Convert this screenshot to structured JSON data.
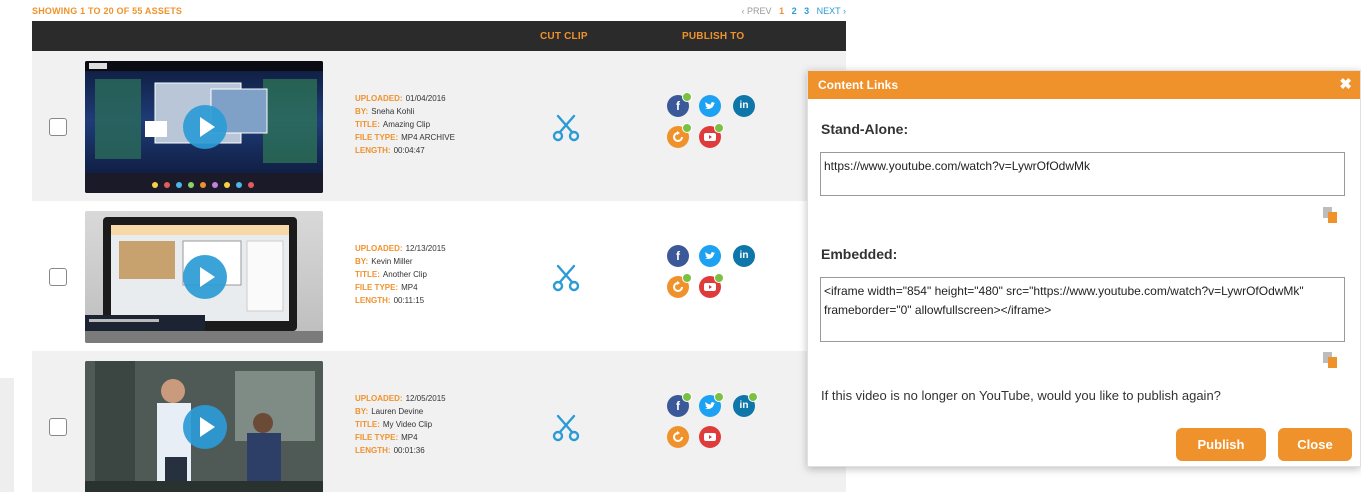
{
  "header": {
    "showing": "SHOWING 1 TO 20 OF 55 ASSETS",
    "pager": {
      "prev": "‹ PREV",
      "pages": [
        "1",
        "2",
        "3"
      ],
      "current": "1",
      "next": "NEXT ›"
    }
  },
  "table": {
    "columns": {
      "cut_clip": "CUT CLIP",
      "publish_to": "PUBLISH TO"
    },
    "labels": {
      "uploaded": "UPLOADED:",
      "by": "BY:",
      "title": "TITLE:",
      "file_type": "FILE TYPE:",
      "length": "LENGTH:"
    },
    "rows": [
      {
        "uploaded": "01/04/2016",
        "by": "Sneha Kohli",
        "title": "Amazing Clip",
        "file_type": "MP4 ARCHIVE",
        "length": "00:04:47"
      },
      {
        "uploaded": "12/13/2015",
        "by": "Kevin Miller",
        "title": "Another Clip",
        "file_type": "MP4",
        "length": "00:11:15"
      },
      {
        "uploaded": "12/05/2015",
        "by": "Lauren Devine",
        "title": "My Video Clip",
        "file_type": "MP4",
        "length": "00:01:36"
      }
    ],
    "social": {
      "facebook": "f",
      "linkedin": "in"
    }
  },
  "modal": {
    "title": "Content Links",
    "close_symbol": "✖",
    "stand_alone_label": "Stand-Alone:",
    "stand_alone_value": "https://www.youtube.com/watch?v=LywrOfOdwMk",
    "embedded_label": "Embedded:",
    "embedded_value": "<iframe width=\"854\" height=\"480\" src=\"https://www.youtube.com/watch?v=LywrOfOdwMk\" frameborder=\"0\" allowfullscreen></iframe>",
    "prompt": "If this video is no longer on YouTube, would you like to publish again?",
    "publish_label": "Publish",
    "close_label": "Close"
  },
  "colors": {
    "accent": "#f0922c",
    "header_bg": "#2b2b2b",
    "link": "#2b9bd6",
    "check": "#7ac143"
  }
}
